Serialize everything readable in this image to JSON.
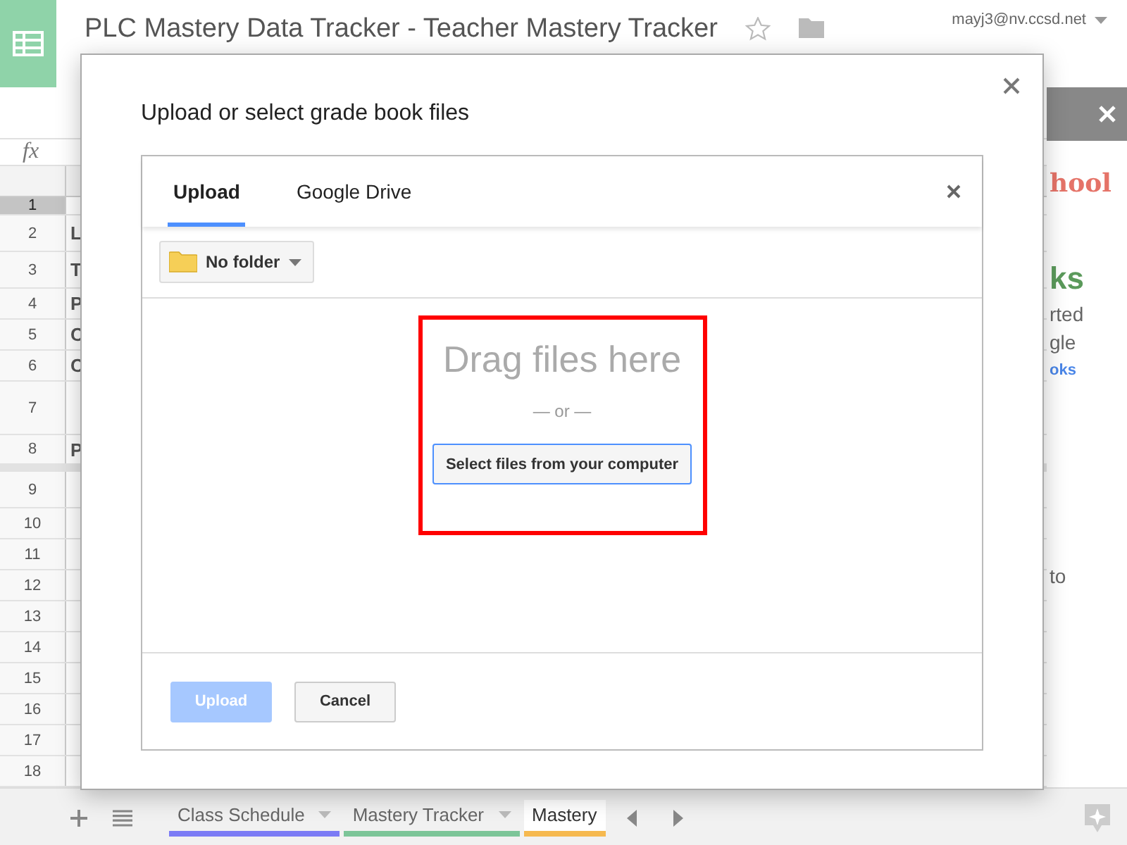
{
  "spreadsheet": {
    "title": "PLC Mastery Data Tracker - Teacher Mastery Tracker",
    "account": "mayj3@nv.ccsd.net",
    "formula_label": "fx",
    "rows": [
      {
        "number": "1",
        "selected": true
      },
      {
        "number": "2",
        "cell": "L",
        "selected": false
      },
      {
        "number": "3",
        "cell": "T",
        "selected": false
      },
      {
        "number": "4",
        "cell": "P",
        "selected": false
      },
      {
        "number": "5",
        "cell": "C",
        "selected": false
      },
      {
        "number": "6",
        "cell": "C",
        "selected": false
      },
      {
        "number": "7",
        "selected": false
      },
      {
        "number": "8",
        "cell": "P",
        "selected": false
      },
      {
        "number": "9",
        "selected": false
      },
      {
        "number": "10",
        "selected": false
      },
      {
        "number": "11",
        "selected": false
      },
      {
        "number": "12",
        "selected": false
      },
      {
        "number": "13",
        "selected": false
      },
      {
        "number": "14",
        "selected": false
      },
      {
        "number": "15",
        "selected": false
      },
      {
        "number": "16",
        "selected": false
      },
      {
        "number": "17",
        "selected": false
      },
      {
        "number": "18",
        "selected": false
      }
    ],
    "sheet_tabs": [
      {
        "label": "Class Schedule",
        "color": "#7b7bf5",
        "selected": false
      },
      {
        "label": "Mastery Tracker",
        "color": "#7cc598",
        "selected": false
      },
      {
        "label": "Mastery",
        "color": "#f6b94f",
        "selected": true
      }
    ],
    "sidebar": {
      "lines": [
        {
          "kind": "brand",
          "text": "hool"
        },
        {
          "kind": "heading",
          "text": "ks"
        },
        {
          "kind": "body",
          "text": "rted"
        },
        {
          "kind": "body",
          "text": "gle"
        },
        {
          "kind": "link",
          "text": "oks"
        },
        {
          "kind": "spacer",
          "text": "to"
        }
      ]
    }
  },
  "dialog": {
    "title": "Upload or select grade book files",
    "tabs": [
      {
        "label": "Upload",
        "selected": true
      },
      {
        "label": "Google Drive",
        "selected": false
      }
    ],
    "folder_button": "No folder",
    "drop_zone": {
      "heading": "Drag files here",
      "separator": "— or —",
      "button": "Select files from your computer"
    },
    "buttons": [
      {
        "label": "Upload",
        "disabled": true,
        "kind": "primary"
      },
      {
        "label": "Cancel",
        "disabled": false,
        "kind": "secondary"
      }
    ]
  }
}
